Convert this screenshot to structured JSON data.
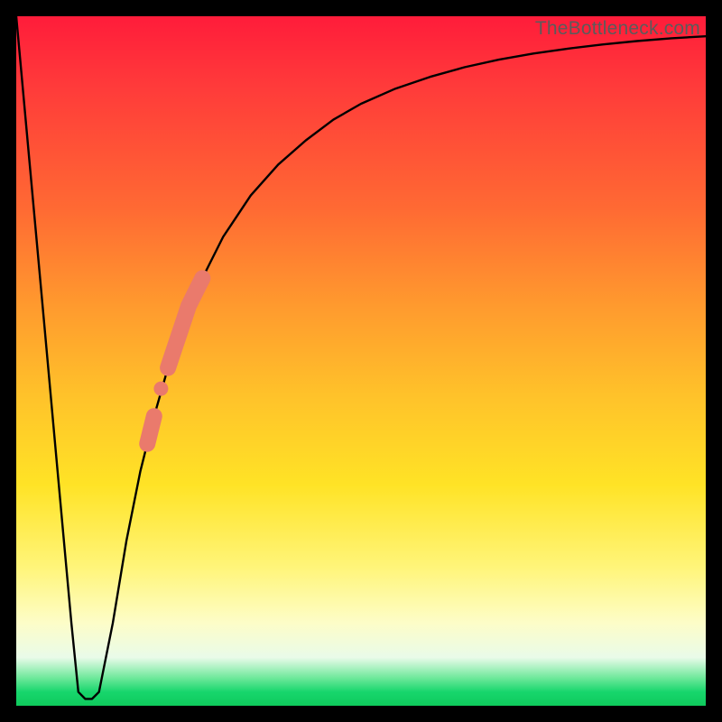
{
  "watermark": "TheBottleneck.com",
  "colors": {
    "curve": "#000000",
    "markers": "#ea7a6c",
    "background_top": "#ff1c3a",
    "background_bottom": "#0fca5c"
  },
  "chart_data": {
    "type": "line",
    "title": "",
    "xlabel": "",
    "ylabel": "",
    "xlim": [
      0,
      100
    ],
    "ylim": [
      0,
      100
    ],
    "grid": false,
    "series": [
      {
        "name": "bottleneck-curve",
        "x": [
          0,
          2,
          4,
          6,
          8,
          9,
          10,
          11,
          12,
          14,
          16,
          18,
          20,
          22,
          24,
          26,
          28,
          30,
          34,
          38,
          42,
          46,
          50,
          55,
          60,
          65,
          70,
          75,
          80,
          85,
          90,
          95,
          100
        ],
        "y": [
          100,
          78,
          56,
          34,
          12,
          2,
          1,
          1,
          2,
          12,
          24,
          34,
          42,
          49,
          55,
          60,
          64,
          68,
          74,
          78.5,
          82,
          85,
          87.3,
          89.5,
          91.2,
          92.6,
          93.7,
          94.6,
          95.3,
          95.9,
          96.4,
          96.8,
          97.1
        ]
      }
    ],
    "highlighted_points": {
      "name": "highlight-segment",
      "x": [
        19,
        20,
        21,
        22,
        23,
        24,
        25,
        26,
        27
      ],
      "y": [
        38,
        42,
        46,
        49,
        52,
        55,
        58,
        60,
        62
      ]
    },
    "highlighted_dots": {
      "name": "highlight-dots",
      "x": [
        21,
        22,
        23
      ],
      "y": [
        46,
        49,
        52
      ]
    }
  }
}
